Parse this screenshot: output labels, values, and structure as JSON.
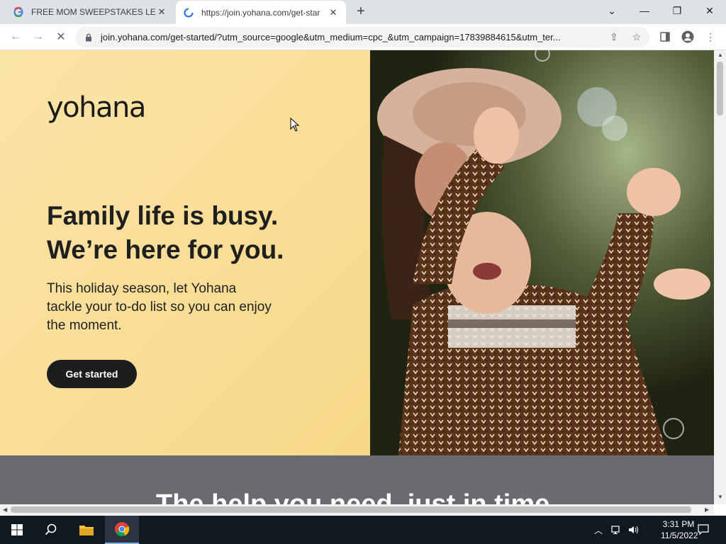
{
  "browser": {
    "tabs": [
      {
        "title": "FREE MOM SWEEPSTAKES LEGIT",
        "active": false
      },
      {
        "title": "https://join.yohana.com/get-star",
        "active": true
      }
    ],
    "url": "join.yohana.com/get-started/?utm_source=google&utm_medium=cpc_&utm_campaign=17839884615&utm_ter..."
  },
  "page": {
    "logo": "yohana",
    "headline_line1": "Family life is busy.",
    "headline_line2": "We’re here for you.",
    "subtext": "This holiday season, let Yohana tackle your to-do list so you can enjoy the moment.",
    "cta_label": "Get started",
    "section_title": "The help you need, just in time"
  },
  "taskbar": {
    "time": "3:31 PM",
    "date": "11/5/2022"
  },
  "colors": {
    "hero_bg": "#f9dd95",
    "cta_bg": "#1d1d1f",
    "band_bg": "#6b6a70"
  }
}
